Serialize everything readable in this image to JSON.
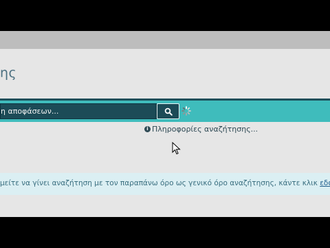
{
  "page": {
    "title_fragment": "ης"
  },
  "search": {
    "input_value": "η αποφάσεων...",
    "button_icon": "search-icon",
    "loading_icon": "spinner-icon"
  },
  "info": {
    "icon": "info-circle-icon",
    "label": "Πληροφορίες αναζήτησης..."
  },
  "notice": {
    "text": "μείτε να γίνει αναζήτηση με τον παραπάνω όρο ως γενικό όρο αναζήτησης, κάντε κλικ ",
    "link_label": "εδώ"
  },
  "colors": {
    "accent_band": "#3fbcbc",
    "input_bg": "#1c4b57",
    "title": "#4a6f80",
    "notice_bg": "#dbeff3",
    "link": "#1f5d8c"
  }
}
